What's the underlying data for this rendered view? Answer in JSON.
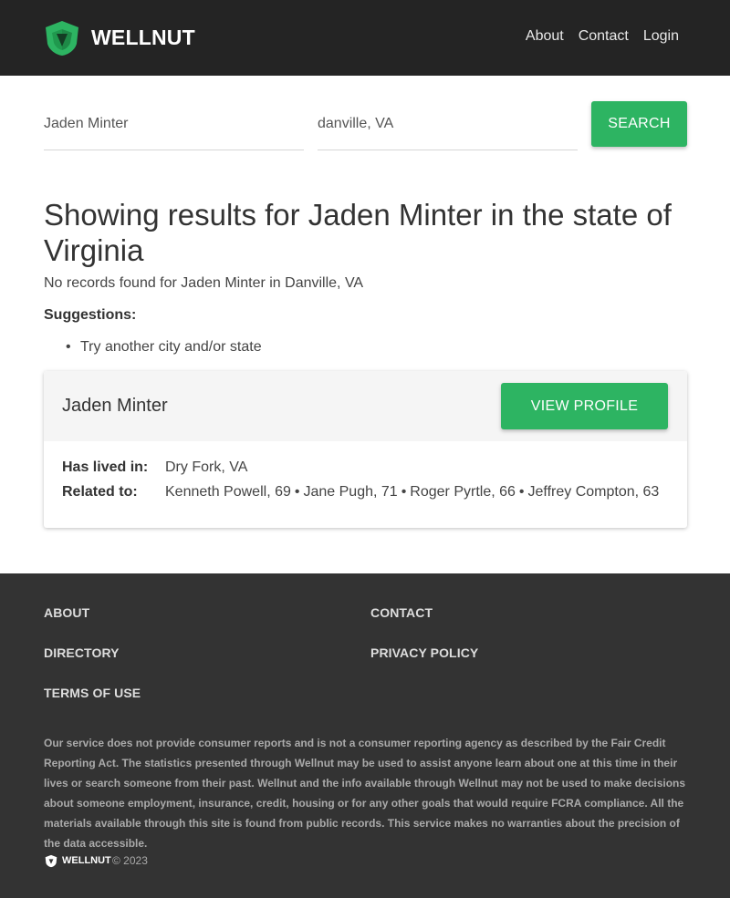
{
  "header": {
    "brand": "WELLNUT",
    "nav": [
      {
        "label": "About"
      },
      {
        "label": "Contact"
      },
      {
        "label": "Login"
      }
    ]
  },
  "search": {
    "name_value": "Jaden Minter",
    "location_value": "danville, VA",
    "button_label": "SEARCH"
  },
  "results": {
    "title": "Showing results for Jaden Minter in the state of Virginia",
    "no_records": "No records found for Jaden Minter in Danville, VA",
    "suggestions_label": "Suggestions:",
    "suggestions": [
      "Try another city and/or state"
    ]
  },
  "card": {
    "name": "Jaden Minter",
    "view_label": "VIEW PROFILE",
    "lived_label": "Has lived in:",
    "lived_value": "Dry Fork, VA",
    "related_label": "Related to:",
    "related": [
      "Kenneth Powell, 69",
      "Jane Pugh, 71",
      "Roger Pyrtle, 66",
      "Jeffrey Compton, 63"
    ],
    "separator": "•"
  },
  "footer": {
    "links": {
      "about": "ABOUT",
      "contact": "CONTACT",
      "directory": "DIRECTORY",
      "privacy": "PRIVACY POLICY",
      "terms": "TERMS OF USE"
    },
    "disclaimer": "Our service does not provide consumer reports and is not a consumer reporting agency as described by the Fair Credit Reporting Act. The statistics presented through Wellnut may be used to assist anyone learn about one at this time in their lives or search someone from their past. Wellnut and the info available through Wellnut may not be used to make decisions about someone employment, insurance, credit, housing or for any other goals that would require FCRA compliance. All the materials available through this site is found from public records. This service makes no warranties about the precision of the data accessible.",
    "brand": "WELLNUT",
    "copyright": "© 2023"
  },
  "colors": {
    "header_bg": "#242424",
    "accent_green": "#2db462",
    "footer_bg": "#333333"
  }
}
